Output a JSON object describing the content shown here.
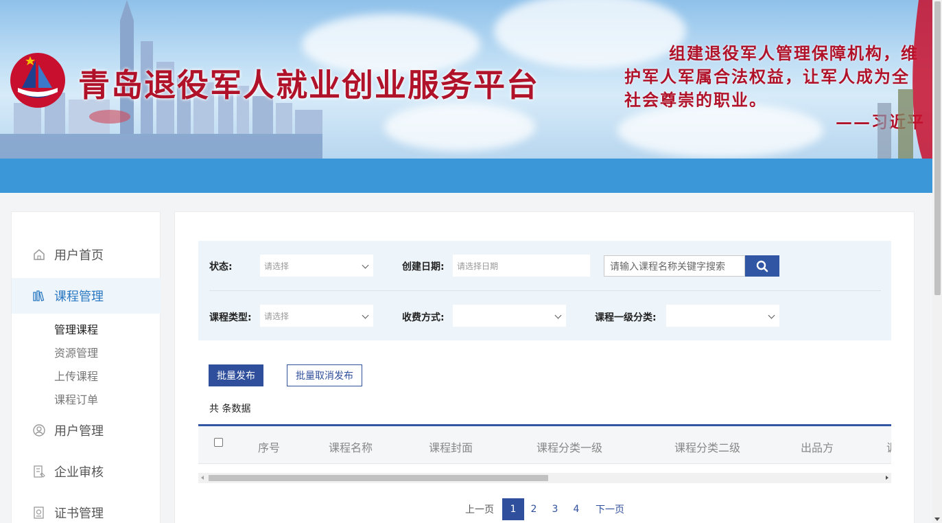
{
  "header": {
    "site_title": "青岛退役军人就业创业服务平台",
    "quote_lines": [
      "组建退役军人管理保障机构，维",
      "护军人军属合法权益，让军人成为全",
      "社会尊崇的职业。",
      "——习近平"
    ]
  },
  "sidebar": {
    "items": [
      {
        "label": "用户首页",
        "icon": "home-icon"
      },
      {
        "label": "课程管理",
        "icon": "books-icon"
      },
      {
        "label": "用户管理",
        "icon": "user-icon"
      },
      {
        "label": "企业审核",
        "icon": "document-icon"
      },
      {
        "label": "证书管理",
        "icon": "certificate-icon"
      }
    ],
    "sub_items": [
      "管理课程",
      "资源管理",
      "上传课程",
      "课程订单"
    ],
    "active_item": "课程管理",
    "active_sub_item": "管理课程"
  },
  "filters": {
    "status_label": "状态:",
    "status_placeholder": "请选择",
    "date_label": "创建日期:",
    "date_placeholder": "请选择日期",
    "search_placeholder": "请输入课程名称关键字搜索",
    "course_type_label": "课程类型:",
    "course_type_placeholder": "请选择",
    "charge_label": "收费方式:",
    "charge_value": "",
    "category_label": "课程一级分类:",
    "category_value": ""
  },
  "actions": {
    "batch_publish": "批量发布",
    "batch_unpublish": "批量取消发布"
  },
  "total_text": "共 条数据",
  "table": {
    "columns": [
      "序号",
      "课程名称",
      "课程封面",
      "课程分类一级",
      "课程分类二级",
      "出品方",
      "调"
    ]
  },
  "pagination": {
    "prev": "上一页",
    "pages": [
      "1",
      "2",
      "3",
      "4"
    ],
    "current": "1",
    "next": "下一页"
  },
  "colors": {
    "brand_red": "#b0122a",
    "header_blue": "#3b97d8",
    "primary": "#2f4f9c"
  }
}
